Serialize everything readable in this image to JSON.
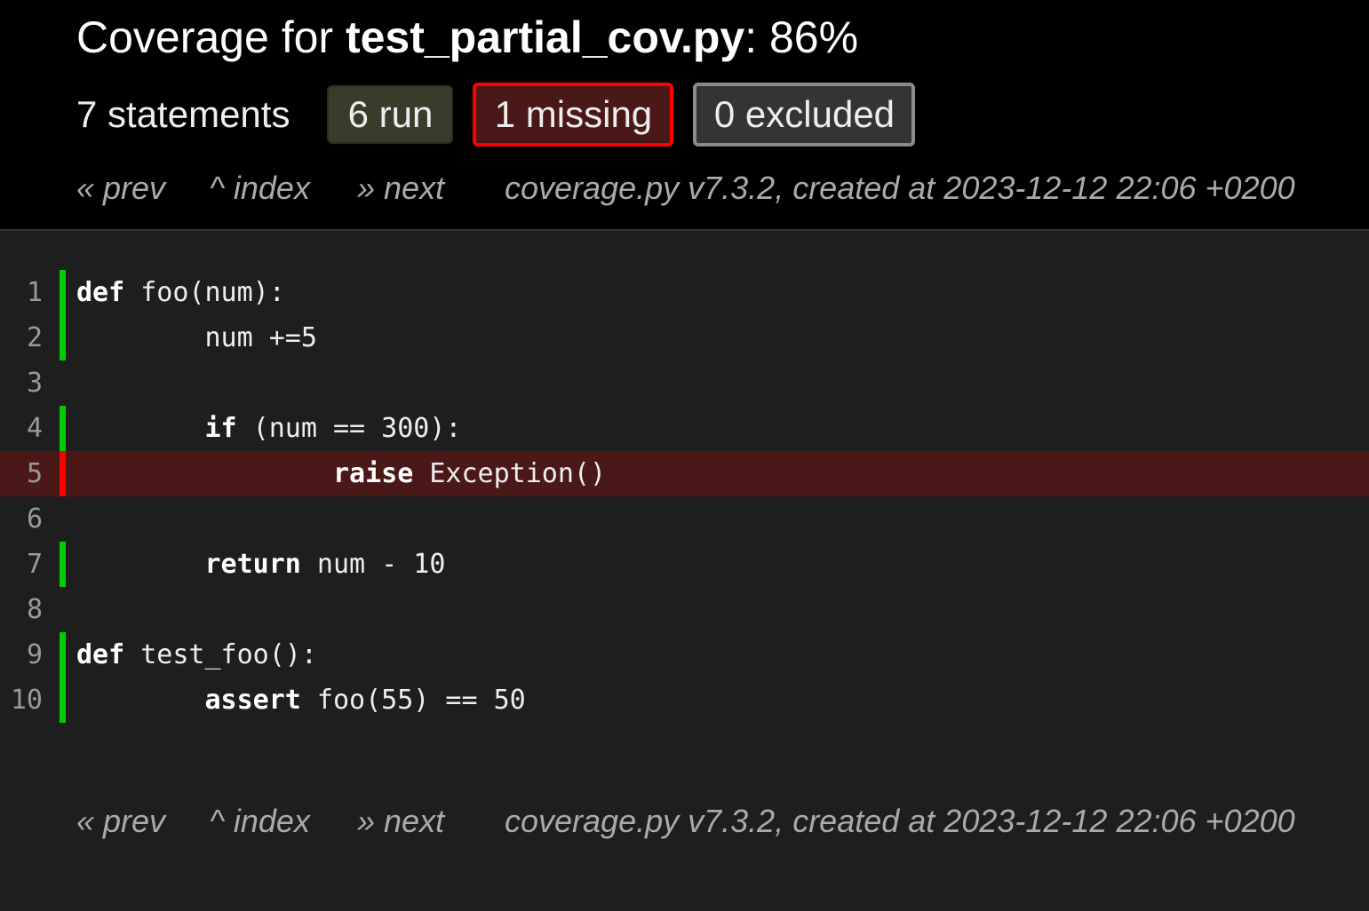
{
  "header": {
    "title_prefix": "Coverage for ",
    "file_name": "test_partial_cov.py",
    "title_suffix": ": 86%",
    "statements": "7 statements",
    "run_label": "6 run",
    "missing_label": "1 missing",
    "excluded_label": "0 excluded"
  },
  "nav": {
    "prev": "« prev",
    "index": "^ index",
    "next": "» next",
    "created": "coverage.py v7.3.2, created at 2023-12-12 22:06 +0200"
  },
  "colors": {
    "run": "#00cc00",
    "missing": "#ff0000",
    "missing_bg": "#4b1818",
    "header_bg": "#000000",
    "body_bg": "#1e1e1e"
  },
  "source": {
    "lines": [
      {
        "num": "1",
        "indent": "",
        "kw": "def",
        "rest": " foo(num):",
        "status": "run"
      },
      {
        "num": "2",
        "indent": "        ",
        "kw": "",
        "rest": "num +=5",
        "status": "run"
      },
      {
        "num": "3",
        "indent": "",
        "kw": "",
        "rest": "",
        "status": "none"
      },
      {
        "num": "4",
        "indent": "        ",
        "kw": "if",
        "rest": " (num == 300):",
        "status": "run"
      },
      {
        "num": "5",
        "indent": "                ",
        "kw": "raise",
        "rest": " Exception()",
        "status": "mis"
      },
      {
        "num": "6",
        "indent": "",
        "kw": "",
        "rest": "",
        "status": "none"
      },
      {
        "num": "7",
        "indent": "        ",
        "kw": "return",
        "rest": " num - 10",
        "status": "run"
      },
      {
        "num": "8",
        "indent": "",
        "kw": "",
        "rest": "",
        "status": "none"
      },
      {
        "num": "9",
        "indent": "",
        "kw": "def",
        "rest": " test_foo():",
        "status": "run"
      },
      {
        "num": "10",
        "indent": "        ",
        "kw": "assert",
        "rest": " foo(55) == 50",
        "status": "run"
      }
    ]
  }
}
